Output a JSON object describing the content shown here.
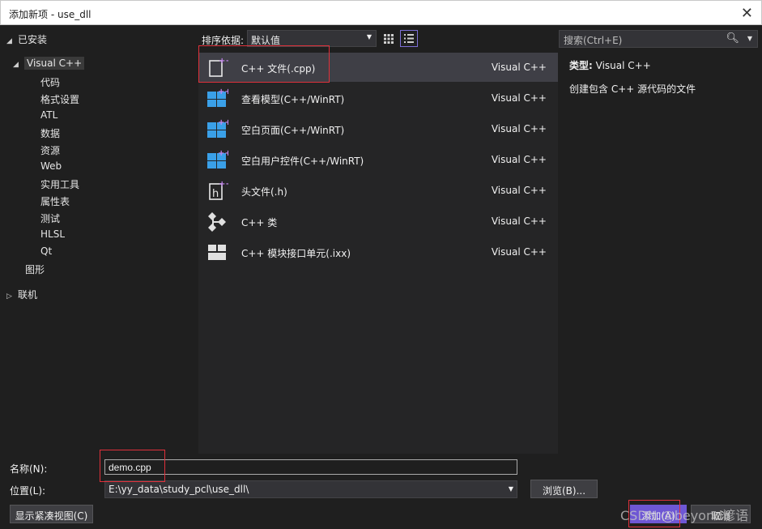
{
  "window": {
    "title": "添加新项 - use_dll"
  },
  "tree": {
    "installed": "已安装",
    "visual_cpp": "Visual C++",
    "children": [
      "代码",
      "格式设置",
      "ATL",
      "数据",
      "资源",
      "Web",
      "实用工具",
      "属性表",
      "测试",
      "HLSL",
      "Qt"
    ],
    "graphics": "图形",
    "online": "联机"
  },
  "toolbar": {
    "sort_label": "排序依据:",
    "sort_value": "默认值"
  },
  "search": {
    "placeholder": "搜索(Ctrl+E)"
  },
  "templates": [
    {
      "name": "C++ 文件(.cpp)",
      "lang": "Visual C++",
      "icon": "cpp-file-icon"
    },
    {
      "name": "查看模型(C++/WinRT)",
      "lang": "Visual C++",
      "icon": "windows-icon"
    },
    {
      "name": "空白页面(C++/WinRT)",
      "lang": "Visual C++",
      "icon": "windows-icon"
    },
    {
      "name": "空白用户控件(C++/WinRT)",
      "lang": "Visual C++",
      "icon": "windows-icon"
    },
    {
      "name": "头文件(.h)",
      "lang": "Visual C++",
      "icon": "header-file-icon"
    },
    {
      "name": "C++ 类",
      "lang": "Visual C++",
      "icon": "class-icon"
    },
    {
      "name": "C++ 模块接口单元(.ixx)",
      "lang": "Visual C++",
      "icon": "module-icon"
    }
  ],
  "details": {
    "type_label": "类型:",
    "type_value": "Visual C++",
    "description": "创建包含 C++ 源代码的文件"
  },
  "form": {
    "name_label": "名称(N):",
    "name_value": "demo.cpp",
    "location_label": "位置(L):",
    "location_value": "E:\\yy_data\\study_pcl\\use_dll\\",
    "browse_label": "浏览(B)...",
    "compact_view_label": "显示紧凑视图(C)",
    "add_label": "添加(A)",
    "cancel_label": "取消"
  },
  "watermark": "CSDN @beyond谚语",
  "colors": {
    "accent": "#6e57d4",
    "highlight_box": "#e0303a",
    "selected_row": "#3f3f46"
  }
}
